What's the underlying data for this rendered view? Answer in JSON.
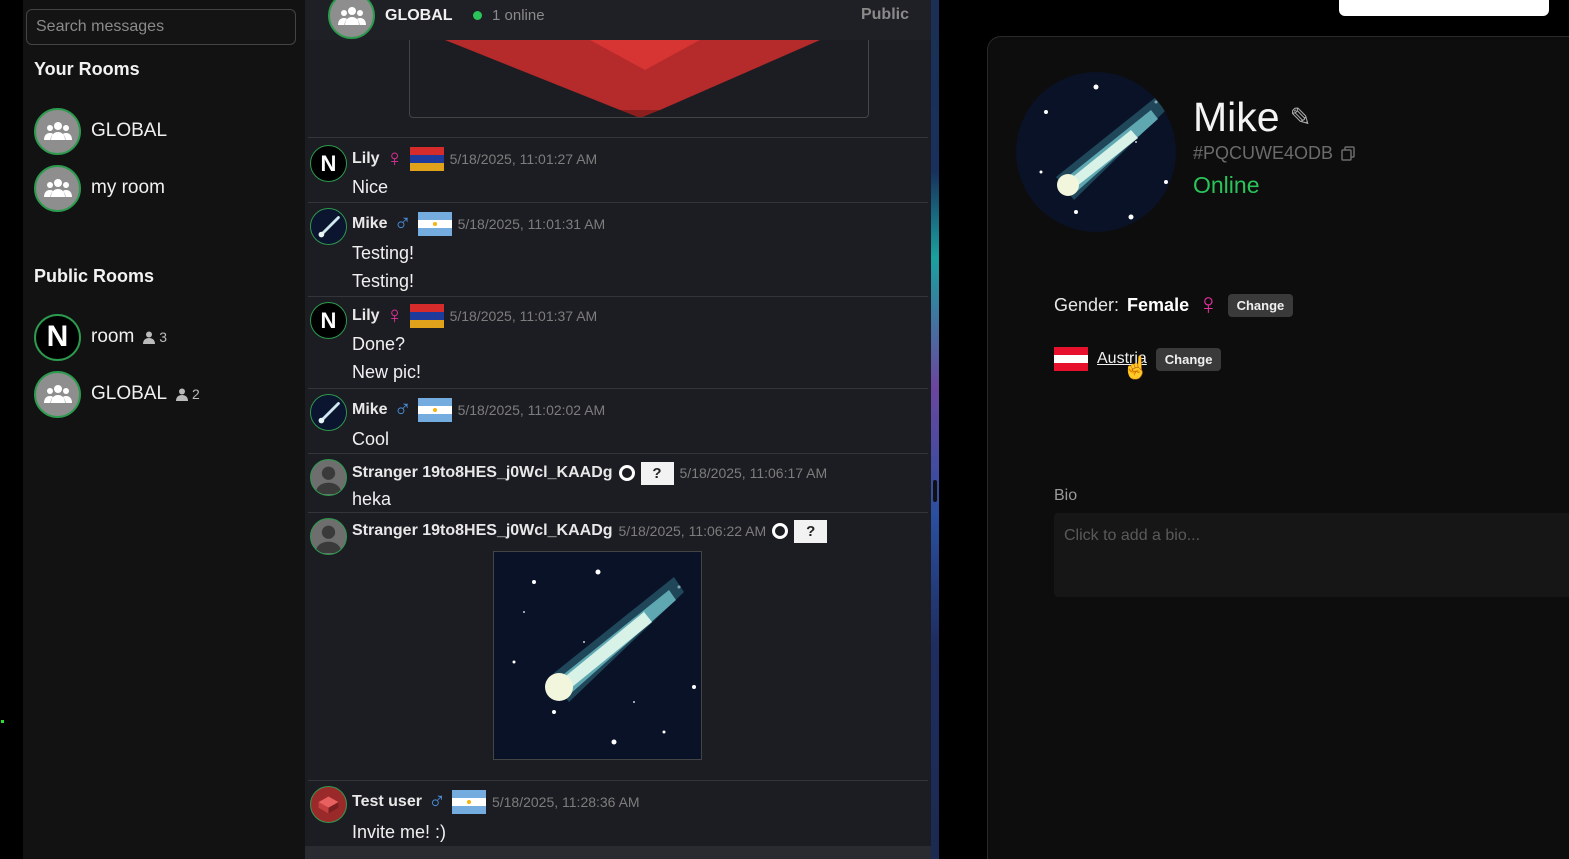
{
  "sidebar": {
    "search_placeholder": "Search messages",
    "your_rooms_title": "Your Rooms",
    "your_rooms": [
      {
        "name": "GLOBAL"
      },
      {
        "name": "my room"
      }
    ],
    "public_rooms_title": "Public Rooms",
    "public_rooms": [
      {
        "name": "room",
        "count": "3",
        "avatar": "N"
      },
      {
        "name": "GLOBAL",
        "count": "2"
      }
    ]
  },
  "chat": {
    "room_name": "GLOBAL",
    "online_text": "1 online",
    "visibility": "Public",
    "messages": [
      {
        "user": "Lily",
        "gender": "female",
        "flag": "armenia",
        "time": "5/18/2025, 11:01:27 AM",
        "avatar": "N",
        "lines": [
          "Nice"
        ]
      },
      {
        "user": "Mike",
        "gender": "male",
        "flag": "argentina",
        "time": "5/18/2025, 11:01:31 AM",
        "lines": [
          "Testing!",
          "Testing!"
        ]
      },
      {
        "user": "Lily",
        "gender": "female",
        "flag": "armenia",
        "time": "5/18/2025, 11:01:37 AM",
        "avatar": "N",
        "lines": [
          "Done?",
          "New pic!"
        ]
      },
      {
        "user": "Mike",
        "gender": "male",
        "flag": "argentina",
        "time": "5/18/2025, 11:02:02 AM",
        "lines": [
          "Cool"
        ]
      },
      {
        "user": "Stranger 19to8HES_j0Wcl_KAADg",
        "gender": "unknown",
        "flag": "unknown",
        "flag_text": "?",
        "time": "5/18/2025, 11:06:17 AM",
        "lines": [
          "heka"
        ]
      },
      {
        "user": "Stranger 19to8HES_j0Wcl_KAADg",
        "gender": "unknown",
        "flag": "unknown",
        "flag_text": "?",
        "time": "5/18/2025, 11:06:22 AM",
        "lines": []
      },
      {
        "user": "Test user",
        "gender": "male",
        "flag": "argentina",
        "time": "5/18/2025, 11:28:36 AM",
        "lines": [
          "Invite me! :)"
        ]
      }
    ]
  },
  "profile": {
    "name": "Mike",
    "id": "#PQCUWE4ODB",
    "status": "Online",
    "gender_label": "Gender:",
    "gender_value": "Female",
    "change_label": "Change",
    "country": "Austria",
    "bio_label": "Bio",
    "bio_placeholder": "Click to add a bio..."
  },
  "colors": {
    "accent_green": "#2bc45b",
    "female": "#e0309a",
    "male": "#4a8fd9"
  }
}
